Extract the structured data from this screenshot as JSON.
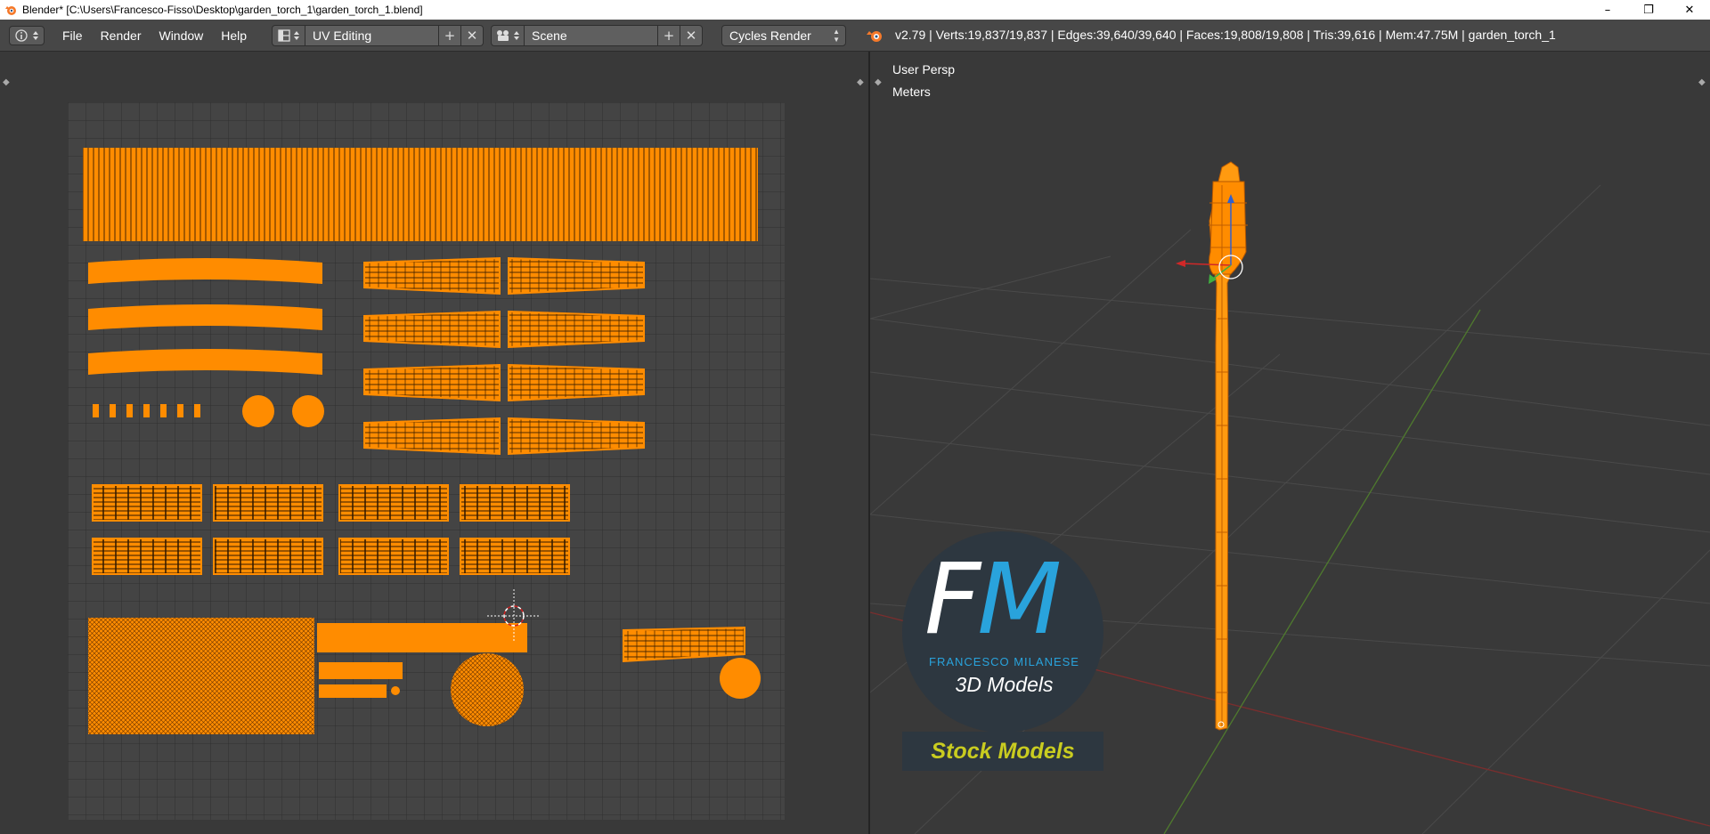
{
  "titlebar": {
    "title": "Blender* [C:\\Users\\Francesco-Fisso\\Desktop\\garden_torch_1\\garden_torch_1.blend]",
    "minimize": "–",
    "restore": "❐",
    "close": "✕"
  },
  "menu": {
    "items": [
      "File",
      "Render",
      "Window",
      "Help"
    ]
  },
  "layout": {
    "value": "UV Editing",
    "add": "+",
    "remove": "✕"
  },
  "scene": {
    "value": "Scene",
    "add": "+",
    "remove": "✕"
  },
  "render_engine": {
    "value": "Cycles Render"
  },
  "stats": {
    "text": "v2.79 | Verts:19,837/19,837 | Edges:39,640/39,640 | Faces:19,808/19,808 | Tris:39,616 | Mem:47.75M | garden_torch_1"
  },
  "viewport": {
    "view_name": "User Persp",
    "units": "Meters"
  },
  "watermark": {
    "monogram_f": "F",
    "monogram_m": "M",
    "author": "FRANCESCO MILANESE",
    "subtitle": "3D Models",
    "banner": "Stock Models"
  },
  "colors": {
    "accent_orange": "#ff8c00",
    "background": "#393939",
    "header": "#474747",
    "brand_blue": "#29a3dc",
    "banner_yellow": "#c9cc20"
  }
}
